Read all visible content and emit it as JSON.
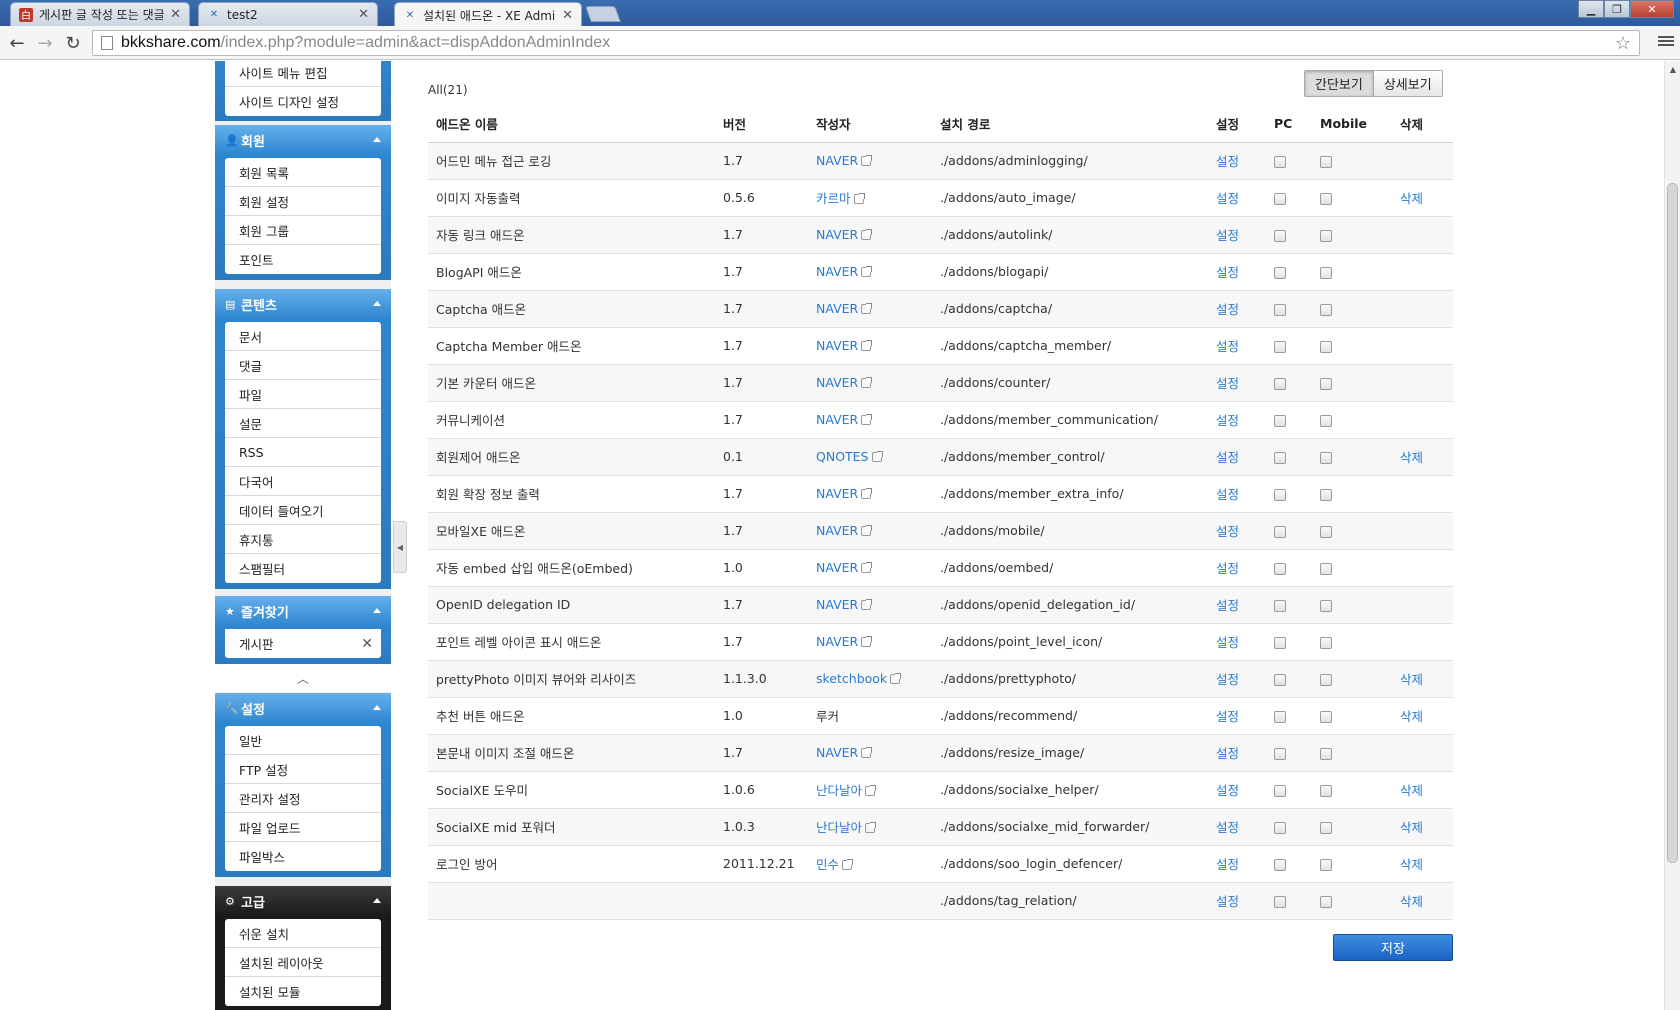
{
  "browser": {
    "tabs": [
      {
        "title": "게시판 글 작성 또는 댓글",
        "favicon_label": "白",
        "favicon_color": "#c0392b"
      },
      {
        "title": "test2",
        "favicon_label": "✕",
        "favicon_color": "#2a6fb4"
      },
      {
        "title": "설치된 애드온 - XE Admi",
        "favicon_label": "✕",
        "favicon_color": "#2a6fb4"
      }
    ],
    "url_host": "bkkshare.com",
    "url_path": "/index.php?module=admin&act=dispAddonAdminIndex"
  },
  "sidebar": {
    "site_items": [
      "사이트 메뉴 편집",
      "사이트 디자인 설정"
    ],
    "member": {
      "title": "회원",
      "items": [
        "회원 목록",
        "회원 설정",
        "회원 그룹",
        "포인트"
      ]
    },
    "contents": {
      "title": "콘텐츠",
      "items": [
        "문서",
        "댓글",
        "파일",
        "설문",
        "RSS",
        "다국어",
        "데이터 들여오기",
        "휴지통",
        "스팸필터"
      ]
    },
    "favorites": {
      "title": "즐겨찾기",
      "items": [
        "게시판"
      ]
    },
    "settings": {
      "title": "설정",
      "items": [
        "일반",
        "FTP 설정",
        "관리자 설정",
        "파일 업로드",
        "파일박스"
      ]
    },
    "advanced": {
      "title": "고급",
      "items": [
        "쉬운 설치",
        "설치된 레이아웃",
        "설치된 모듈"
      ]
    }
  },
  "main": {
    "count_label": "All(21)",
    "view_simple": "간단보기",
    "view_detail": "상세보기",
    "headers": {
      "name": "애드온 이름",
      "version": "버전",
      "author": "작성자",
      "path": "설치 경로",
      "setting": "설정",
      "pc": "PC",
      "mobile": "Mobile",
      "delete": "삭제"
    },
    "setting_label": "설정",
    "delete_label": "삭제",
    "save_label": "저장",
    "rows": [
      {
        "name": "어드민 메뉴 접근 로깅",
        "version": "1.7",
        "author": "NAVER",
        "author_link": true,
        "path": "./addons/adminlogging/",
        "deletable": false
      },
      {
        "name": "이미지 자동출력",
        "version": "0.5.6",
        "author": "카르마",
        "author_link": true,
        "path": "./addons/auto_image/",
        "deletable": true
      },
      {
        "name": "자동 링크 애드온",
        "version": "1.7",
        "author": "NAVER",
        "author_link": true,
        "path": "./addons/autolink/",
        "deletable": false
      },
      {
        "name": "BlogAPI 애드온",
        "version": "1.7",
        "author": "NAVER",
        "author_link": true,
        "path": "./addons/blogapi/",
        "deletable": false
      },
      {
        "name": "Captcha 애드온",
        "version": "1.7",
        "author": "NAVER",
        "author_link": true,
        "path": "./addons/captcha/",
        "deletable": false
      },
      {
        "name": "Captcha Member 애드온",
        "version": "1.7",
        "author": "NAVER",
        "author_link": true,
        "path": "./addons/captcha_member/",
        "deletable": false
      },
      {
        "name": "기본 카운터 애드온",
        "version": "1.7",
        "author": "NAVER",
        "author_link": true,
        "path": "./addons/counter/",
        "deletable": false
      },
      {
        "name": "커뮤니케이션",
        "version": "1.7",
        "author": "NAVER",
        "author_link": true,
        "path": "./addons/member_communication/",
        "deletable": false
      },
      {
        "name": "회원제어 애드온",
        "version": "0.1",
        "author": "QNOTES",
        "author_link": true,
        "path": "./addons/member_control/",
        "deletable": true
      },
      {
        "name": "회원 확장 정보 출력",
        "version": "1.7",
        "author": "NAVER",
        "author_link": true,
        "path": "./addons/member_extra_info/",
        "deletable": false
      },
      {
        "name": "모바일XE 애드온",
        "version": "1.7",
        "author": "NAVER",
        "author_link": true,
        "path": "./addons/mobile/",
        "deletable": false
      },
      {
        "name": "자동 embed 삽입 애드온(oEmbed)",
        "version": "1.0",
        "author": "NAVER",
        "author_link": true,
        "path": "./addons/oembed/",
        "deletable": false
      },
      {
        "name": "OpenID delegation ID",
        "version": "1.7",
        "author": "NAVER",
        "author_link": true,
        "path": "./addons/openid_delegation_id/",
        "deletable": false
      },
      {
        "name": "포인트 레벨 아이콘 표시 애드온",
        "version": "1.7",
        "author": "NAVER",
        "author_link": true,
        "path": "./addons/point_level_icon/",
        "deletable": false
      },
      {
        "name": "prettyPhoto 이미지 뷰어와 리사이즈",
        "version": "1.1.3.0",
        "author": "sketchbook",
        "author_link": true,
        "path": "./addons/prettyphoto/",
        "deletable": true
      },
      {
        "name": "추천 버튼 애드온",
        "version": "1.0",
        "author": "루커",
        "author_link": false,
        "path": "./addons/recommend/",
        "deletable": true
      },
      {
        "name": "본문내 이미지 조절 애드온",
        "version": "1.7",
        "author": "NAVER",
        "author_link": true,
        "path": "./addons/resize_image/",
        "deletable": false
      },
      {
        "name": "SocialXE 도우미",
        "version": "1.0.6",
        "author": "난다날아",
        "author_link": true,
        "path": "./addons/socialxe_helper/",
        "deletable": true
      },
      {
        "name": "SocialXE mid 포워더",
        "version": "1.0.3",
        "author": "난다날아",
        "author_link": true,
        "path": "./addons/socialxe_mid_forwarder/",
        "deletable": true
      },
      {
        "name": "로그인 방어",
        "version": "2011.12.21",
        "author": "민수",
        "author_link": true,
        "path": "./addons/soo_login_defencer/",
        "deletable": true
      },
      {
        "name": "",
        "version": "",
        "author": "",
        "author_link": false,
        "path": "./addons/tag_relation/",
        "deletable": true
      }
    ]
  }
}
